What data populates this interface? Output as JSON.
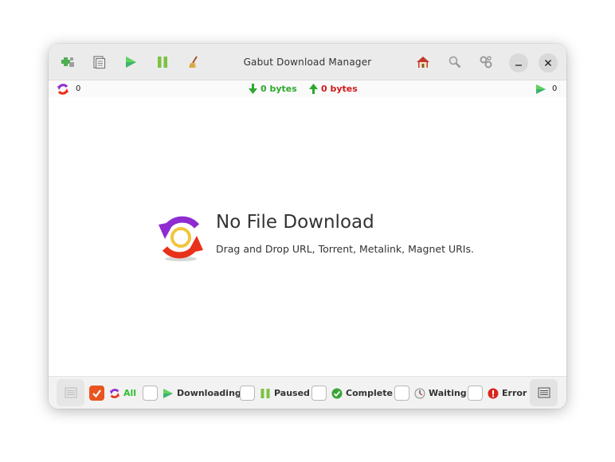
{
  "window": {
    "title": "Gabut Download Manager"
  },
  "stats": {
    "active_count": "0",
    "download_speed": "0 bytes",
    "upload_speed": "0 bytes",
    "running_count": "0"
  },
  "empty_state": {
    "title": "No File Download",
    "subtitle": "Drag and Drop URL, Torrent, Metalink, Magnet URIs."
  },
  "filters": [
    {
      "label": "All",
      "checked": true
    },
    {
      "label": "Downloading",
      "checked": false
    },
    {
      "label": "Paused",
      "checked": false
    },
    {
      "label": "Complete",
      "checked": false
    },
    {
      "label": "Waiting",
      "checked": false
    },
    {
      "label": "Error",
      "checked": false
    }
  ],
  "icons": {
    "toolbar": [
      "add-icon",
      "properties-icon",
      "start-icon",
      "pause-icon",
      "clean-icon"
    ],
    "header_right": [
      "home-icon",
      "search-icon",
      "settings-icon"
    ],
    "window_controls": [
      "minimize-icon",
      "close-icon"
    ]
  },
  "colors": {
    "accent": "#e95420",
    "download_green": "#2ea82e",
    "upload_red": "#d11a1a",
    "logo_purple": "#8e2bd1",
    "logo_red": "#e8311a"
  }
}
